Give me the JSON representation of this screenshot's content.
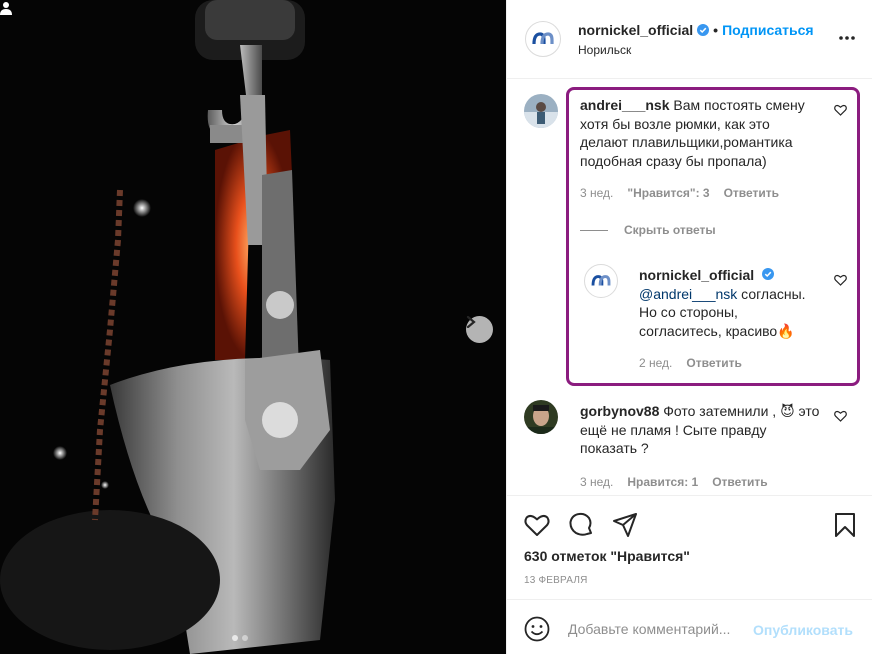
{
  "post": {
    "username": "nornickel_official",
    "follow_label": "Подписаться",
    "bullet": "•",
    "location": "Норильск",
    "photo_dots": 2,
    "active_dot": 1
  },
  "comments": [
    {
      "username": "andrei___nsk",
      "text": "Вам постоять смену хотя бы возле рюмки, как это делают плавильщики,романтика подобная сразу бы пропала)",
      "time": "3 нед.",
      "likes": "\"Нравится\": 3",
      "reply": "Ответить",
      "hide_replies": "Скрыть ответы",
      "replies": [
        {
          "username": "nornickel_official",
          "mention": "@andrei___nsk",
          "text": " согласны. Но со стороны, согласитесь, красиво🔥",
          "time": "2 нед.",
          "reply": "Ответить"
        }
      ]
    },
    {
      "username": "gorbynov88",
      "text": "Фото затемнили , 😈 это ещё не пламя ! Сыте правду показать ?",
      "time": "3 нед.",
      "likes": "Нравится: 1",
      "reply": "Ответить"
    }
  ],
  "actions": {
    "likes_count": "630 отметок \"Нравится\"",
    "date": "13 ФЕВРАЛЯ"
  },
  "add_comment": {
    "placeholder": "Добавьте комментарий...",
    "publish_label": "Опубликовать"
  },
  "colors": {
    "accent": "#0095f6",
    "highlight_border": "#8b1c7f",
    "muted": "#8e8e8e"
  }
}
